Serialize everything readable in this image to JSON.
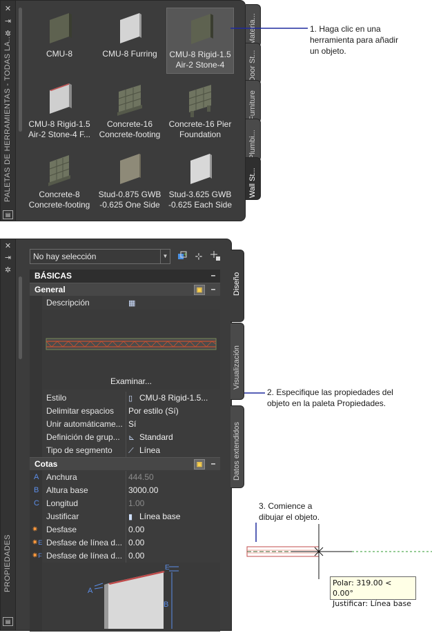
{
  "tool_palette": {
    "title": "PALETAS DE HERRAMIENTAS - TODAS LA...",
    "tools": [
      {
        "label": "CMU-8",
        "icon": "wall-cmu-icon"
      },
      {
        "label": "CMU-8 Furring",
        "icon": "wall-furring-icon"
      },
      {
        "label": "CMU-8 Rigid-1.5 Air-2 Stone-4",
        "icon": "wall-rigid-icon",
        "selected": true
      },
      {
        "label": "CMU-8 Rigid-1.5 Air-2 Stone-4 F...",
        "icon": "wall-stone-icon"
      },
      {
        "label": "Concrete-16 Concrete-footing",
        "icon": "wall-concrete-footing-icon"
      },
      {
        "label": "Concrete-16 Pier Foundation",
        "icon": "wall-pier-icon"
      },
      {
        "label": "Concrete-8 Concrete-footing",
        "icon": "wall-concrete8-icon"
      },
      {
        "label": "Stud-0.875 GWB -0.625 One Side",
        "icon": "wall-stud-one-icon"
      },
      {
        "label": "Stud-3.625 GWB -0.625 Each Side",
        "icon": "wall-stud-each-icon"
      }
    ],
    "tabs": [
      "Materia...",
      "Door St...",
      "Furniture",
      "Plumbi...",
      "Wall St..."
    ],
    "active_tab": "Wall St..."
  },
  "properties": {
    "title": "PROPIEDADES",
    "selection": "No hay selección",
    "tabs": [
      "Diseño",
      "Visualización",
      "Datos extendidos"
    ],
    "sections": {
      "basicas": "BÁSICAS",
      "general": "General",
      "cotas": "Cotas"
    },
    "descripcion_label": "Descripción",
    "examinar_label": "Examinar...",
    "general_rows": [
      {
        "name": "Estilo",
        "value": "CMU-8 Rigid-1.5...",
        "icon": "wall-style-icon"
      },
      {
        "name": "Delimitar espacios",
        "value": "Por estilo (Sí)"
      },
      {
        "name": "Unir automáticame...",
        "value": "Sí"
      },
      {
        "name": "Definición de grup...",
        "value": "Standard",
        "icon": "cleanup-group-icon"
      },
      {
        "name": "Tipo de segmento",
        "value": "Línea",
        "icon": "line-segment-icon"
      }
    ],
    "cotas_rows": [
      {
        "letter": "A",
        "name": "Anchura",
        "value": "444.50",
        "dim": true
      },
      {
        "letter": "B",
        "name": "Altura base",
        "value": "3000.00"
      },
      {
        "letter": "C",
        "name": "Longitud",
        "value": "1.00",
        "dim": true
      },
      {
        "letter": "",
        "name": "Justificar",
        "value": "Línea base",
        "icon": "justify-icon"
      },
      {
        "letter": "",
        "name": "Desfase",
        "value": "0.00",
        "star": true
      },
      {
        "letter": "E",
        "name": "Desfase de línea d...",
        "value": "0.00",
        "star": true
      },
      {
        "letter": "F",
        "name": "Desfase de línea d...",
        "value": "0.00",
        "star": true
      }
    ],
    "diagram_letters": [
      "A",
      "B",
      "E"
    ]
  },
  "callouts": {
    "step1": "1. Haga clic en una herramienta para añadir un objeto.",
    "step2": "2. Especifique las propiedades del objeto en la paleta Propiedades.",
    "step3": "3. Comience a dibujar el objeto."
  },
  "tooltip": {
    "line1": "Polar: 319.00 < 0.00°",
    "line2": "Justificar: Línea base"
  },
  "colors": {
    "palette_bg": "#3c3c3c",
    "callout_line": "#1f2a9e",
    "dim_letter": "#5c8ee8"
  }
}
